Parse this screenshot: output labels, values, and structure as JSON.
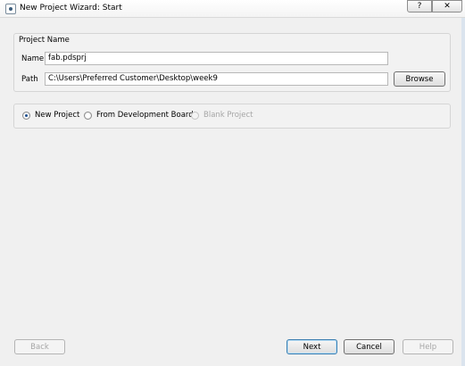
{
  "window": {
    "title": "New Project Wizard: Start",
    "help_caption": "?",
    "close_caption": "✕"
  },
  "project_group": {
    "title": "Project Name",
    "name_label": "Name",
    "name_value": "fab.pdsprj",
    "path_label": "Path",
    "path_value": "C:\\Users\\Preferred Customer\\Desktop\\week9",
    "browse_label": "Browse"
  },
  "project_type": {
    "options": [
      {
        "label": "New Project",
        "checked": true,
        "enabled": true
      },
      {
        "label": "From Development Board",
        "checked": false,
        "enabled": true
      },
      {
        "label": "Blank Project",
        "checked": false,
        "enabled": false
      }
    ]
  },
  "footer": {
    "back_label": "Back",
    "next_label": "Next",
    "cancel_label": "Cancel",
    "help_label": "Help"
  },
  "icons": {
    "app": "wizard-app-icon",
    "help": "help-icon",
    "close": "close-icon"
  }
}
